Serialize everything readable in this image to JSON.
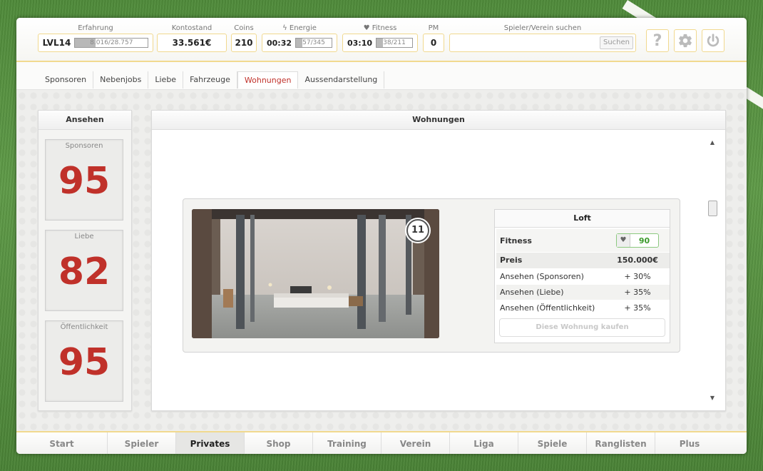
{
  "header": {
    "level": "LVL14",
    "experience": {
      "label": "Erfahrung",
      "text": "8.016/28.757",
      "progress": 0.28
    },
    "balance": {
      "label": "Kontostand",
      "value": "33.561€"
    },
    "coins": {
      "label": "Coins",
      "value": "210"
    },
    "energy": {
      "label": "Energie",
      "time": "00:32",
      "text": "57/345",
      "progress": 0.17
    },
    "fitness": {
      "label": "Fitness",
      "time": "03:10",
      "text": "38/211",
      "progress": 0.18
    },
    "pm": {
      "label": "PM",
      "value": "0"
    },
    "search": {
      "label": "Spieler/Verein suchen",
      "value": "",
      "placeholder": "",
      "button": "Suchen"
    },
    "icons": {
      "help": "question-mark-icon",
      "settings": "gear-icon",
      "logout": "power-icon"
    }
  },
  "subnav": {
    "tabs": [
      {
        "label": "Sponsoren"
      },
      {
        "label": "Nebenjobs"
      },
      {
        "label": "Liebe"
      },
      {
        "label": "Fahrzeuge"
      },
      {
        "label": "Wohnungen",
        "active": true
      },
      {
        "label": "Aussendarstellung"
      }
    ]
  },
  "reputation": {
    "title": "Ansehen",
    "items": [
      {
        "label": "Sponsoren",
        "value": "95"
      },
      {
        "label": "Liebe",
        "value": "82"
      },
      {
        "label": "Öffentlichkeit",
        "value": "95"
      }
    ]
  },
  "apartments": {
    "title": "Wohnungen",
    "card": {
      "badge": "11",
      "name": "Loft",
      "fitness_label": "Fitness",
      "fitness_value": "90",
      "price_label": "Preis",
      "price_value": "150.000€",
      "rows": [
        {
          "label": "Ansehen (Sponsoren)",
          "value": "+ 30%"
        },
        {
          "label": "Ansehen (Liebe)",
          "value": "+ 35%"
        },
        {
          "label": "Ansehen (Öffentlichkeit)",
          "value": "+ 35%"
        }
      ],
      "buy_button": "Diese Wohnung kaufen"
    }
  },
  "bottomnav": {
    "items": [
      {
        "label": "Start"
      },
      {
        "label": "Spieler"
      },
      {
        "label": "Privates",
        "active": true
      },
      {
        "label": "Shop"
      },
      {
        "label": "Training"
      },
      {
        "label": "Verein"
      },
      {
        "label": "Liga"
      },
      {
        "label": "Spiele"
      },
      {
        "label": "Ranglisten"
      },
      {
        "label": "Plus"
      }
    ]
  },
  "colors": {
    "accent_red": "#c0312a",
    "fitness_green": "#3a9a2a",
    "border_gold": "#f1d98f"
  }
}
